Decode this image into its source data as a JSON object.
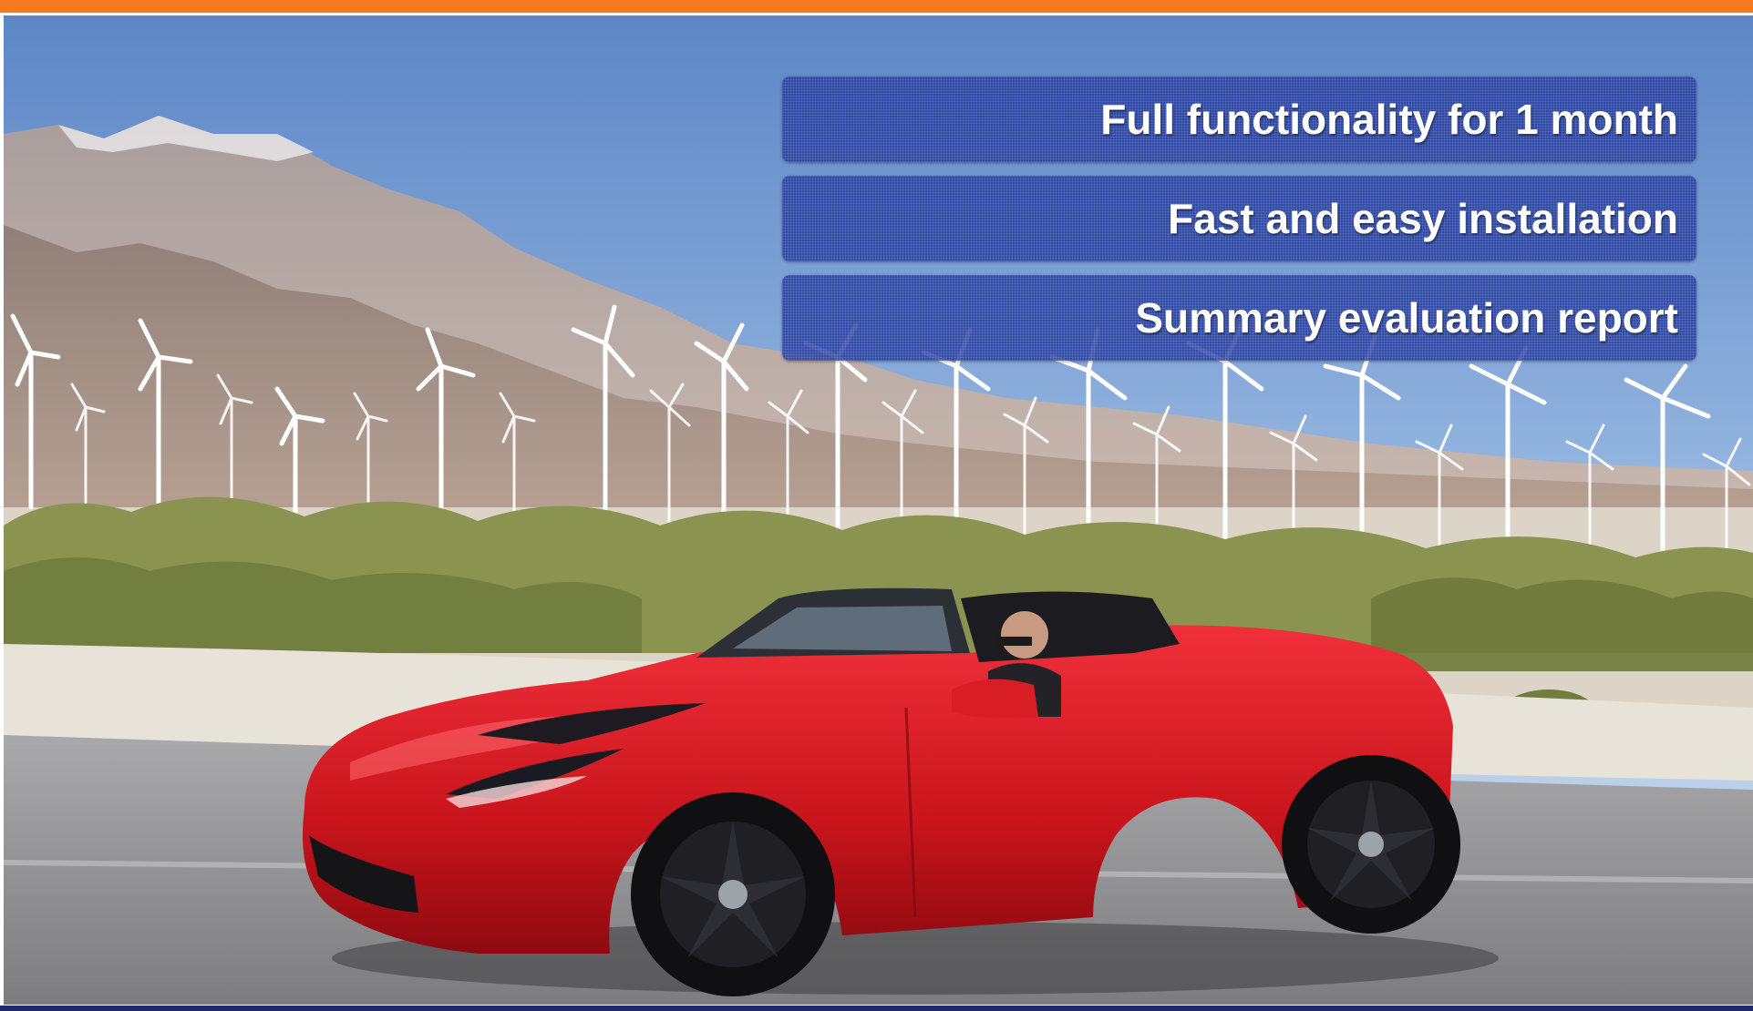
{
  "features": [
    "Full functionality for 1 month",
    "Fast and easy installation",
    "Summary evaluation report"
  ],
  "colors": {
    "accent_bar": "#f47a20",
    "footer_bar": "#1f2a6b",
    "feature_panel": "#263ea0",
    "car": "#d51a1f"
  },
  "scene": {
    "photo": "red convertible sports car driving past a desert wind farm with mountains",
    "icons": [
      "wind-turbine-icon",
      "car-icon"
    ]
  }
}
